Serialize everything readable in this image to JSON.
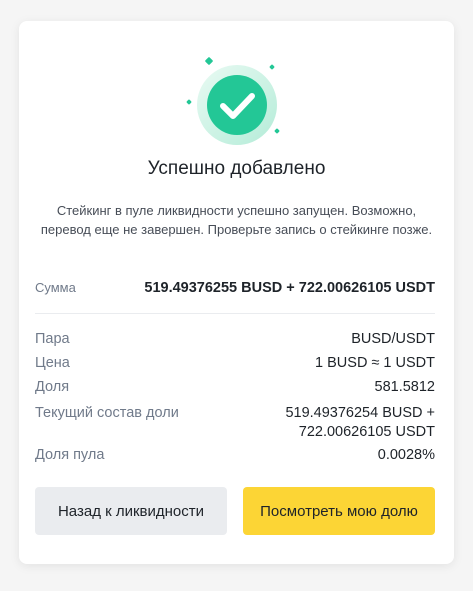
{
  "dialog": {
    "title": "Успешно добавлено",
    "description": "Стейкинг в пуле ликвидности успешно запущен. Возможно, перевод еще не завершен. Проверьте запись о стейкинге позже.",
    "success_icon": "check-circle-icon",
    "accent_color": "#23c796",
    "sum": {
      "label": "Сумма",
      "value": "519.49376255 BUSD + 722.00626105 USDT"
    },
    "details": [
      {
        "label": "Пара",
        "value": "BUSD/USDT"
      },
      {
        "label": "Цена",
        "value": "1 BUSD ≈ 1 USDT"
      },
      {
        "label": "Доля",
        "value": "581.5812"
      },
      {
        "label": "Текущий состав доли",
        "value": "519.49376254 BUSD + 722.00626105 USDT"
      },
      {
        "label": "Доля пула",
        "value": "0.0028%"
      }
    ],
    "buttons": {
      "back_label": "Назад к ликвидности",
      "view_label": "Посмотреть мою долю",
      "primary_color": "#fcd535"
    }
  }
}
